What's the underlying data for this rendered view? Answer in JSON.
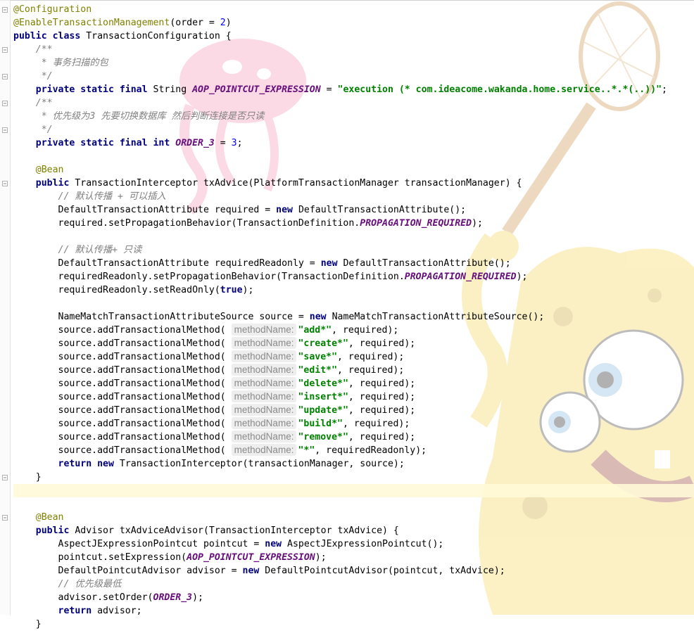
{
  "code": {
    "lines": [
      [
        [
          "ann",
          "@Configuration"
        ]
      ],
      [
        [
          "ann",
          "@EnableTransactionManagement"
        ],
        [
          "p",
          "(order = "
        ],
        [
          "num",
          "2"
        ],
        [
          "p",
          ")"
        ]
      ],
      [
        [
          "kw",
          "public class "
        ],
        [
          "p",
          "TransactionConfiguration {"
        ]
      ],
      [
        [
          "p",
          "    "
        ],
        [
          "cm",
          "/**"
        ]
      ],
      [
        [
          "p",
          "    "
        ],
        [
          "cm",
          " * 事务扫描的包"
        ]
      ],
      [
        [
          "p",
          "    "
        ],
        [
          "cm",
          " */"
        ]
      ],
      [
        [
          "p",
          "    "
        ],
        [
          "kw",
          "private static final "
        ],
        [
          "p",
          "String "
        ],
        [
          "const",
          "AOP_POINTCUT_EXPRESSION"
        ],
        [
          "p",
          " = "
        ],
        [
          "str",
          "\"execution (* com.ideacome.wakanda.home.service..*.*(..))\""
        ],
        [
          "p",
          ";"
        ]
      ],
      [
        [
          "p",
          "    "
        ],
        [
          "cm",
          "/**"
        ]
      ],
      [
        [
          "p",
          "    "
        ],
        [
          "cm",
          " * 优先级为3 先要切换数据库 然后判断连接是否只读"
        ]
      ],
      [
        [
          "p",
          "    "
        ],
        [
          "cm",
          " */"
        ]
      ],
      [
        [
          "p",
          "    "
        ],
        [
          "kw",
          "private static final int "
        ],
        [
          "const",
          "ORDER_3"
        ],
        [
          "p",
          " = "
        ],
        [
          "num",
          "3"
        ],
        [
          "p",
          ";"
        ]
      ],
      [
        [
          "p",
          ""
        ]
      ],
      [
        [
          "p",
          "    "
        ],
        [
          "ann",
          "@Bean"
        ]
      ],
      [
        [
          "p",
          "    "
        ],
        [
          "kw",
          "public "
        ],
        [
          "p",
          "TransactionInterceptor txAdvice(PlatformTransactionManager transactionManager) {"
        ]
      ],
      [
        [
          "p",
          "        "
        ],
        [
          "cm",
          "// 默认传播 + 可以插入"
        ]
      ],
      [
        [
          "p",
          "        DefaultTransactionAttribute required = "
        ],
        [
          "kw",
          "new "
        ],
        [
          "p",
          "DefaultTransactionAttribute();"
        ]
      ],
      [
        [
          "p",
          "        required.setPropagationBehavior(TransactionDefinition."
        ],
        [
          "const",
          "PROPAGATION_REQUIRED"
        ],
        [
          "p",
          ");"
        ]
      ],
      [
        [
          "p",
          ""
        ]
      ],
      [
        [
          "p",
          "        "
        ],
        [
          "cm",
          "// 默认传播+ 只读"
        ]
      ],
      [
        [
          "p",
          "        DefaultTransactionAttribute requiredReadonly = "
        ],
        [
          "kw",
          "new "
        ],
        [
          "p",
          "DefaultTransactionAttribute();"
        ]
      ],
      [
        [
          "p",
          "        requiredReadonly.setPropagationBehavior(TransactionDefinition."
        ],
        [
          "const",
          "PROPAGATION_REQUIRED"
        ],
        [
          "p",
          ");"
        ]
      ],
      [
        [
          "p",
          "        requiredReadonly.setReadOnly("
        ],
        [
          "kw",
          "true"
        ],
        [
          "p",
          ");"
        ]
      ],
      [
        [
          "p",
          ""
        ]
      ],
      [
        [
          "p",
          "        NameMatchTransactionAttributeSource source = "
        ],
        [
          "kw",
          "new "
        ],
        [
          "p",
          "NameMatchTransactionAttributeSource();"
        ]
      ],
      [
        [
          "p",
          "        source.addTransactionalMethod( "
        ],
        [
          "hint",
          "methodName:"
        ],
        [
          "str",
          "\"add*\""
        ],
        [
          "p",
          ", required);"
        ]
      ],
      [
        [
          "p",
          "        source.addTransactionalMethod( "
        ],
        [
          "hint",
          "methodName:"
        ],
        [
          "str",
          "\"create*\""
        ],
        [
          "p",
          ", required);"
        ]
      ],
      [
        [
          "p",
          "        source.addTransactionalMethod( "
        ],
        [
          "hint",
          "methodName:"
        ],
        [
          "str",
          "\"save*\""
        ],
        [
          "p",
          ", required);"
        ]
      ],
      [
        [
          "p",
          "        source.addTransactionalMethod( "
        ],
        [
          "hint",
          "methodName:"
        ],
        [
          "str",
          "\"edit*\""
        ],
        [
          "p",
          ", required);"
        ]
      ],
      [
        [
          "p",
          "        source.addTransactionalMethod( "
        ],
        [
          "hint",
          "methodName:"
        ],
        [
          "str",
          "\"delete*\""
        ],
        [
          "p",
          ", required);"
        ]
      ],
      [
        [
          "p",
          "        source.addTransactionalMethod( "
        ],
        [
          "hint",
          "methodName:"
        ],
        [
          "str",
          "\"insert*\""
        ],
        [
          "p",
          ", required);"
        ]
      ],
      [
        [
          "p",
          "        source.addTransactionalMethod( "
        ],
        [
          "hint",
          "methodName:"
        ],
        [
          "str",
          "\"update*\""
        ],
        [
          "p",
          ", required);"
        ]
      ],
      [
        [
          "p",
          "        source.addTransactionalMethod( "
        ],
        [
          "hint",
          "methodName:"
        ],
        [
          "str",
          "\"build*\""
        ],
        [
          "p",
          ", required);"
        ]
      ],
      [
        [
          "p",
          "        source.addTransactionalMethod( "
        ],
        [
          "hint",
          "methodName:"
        ],
        [
          "str",
          "\"remove*\""
        ],
        [
          "p",
          ", required);"
        ]
      ],
      [
        [
          "p",
          "        source.addTransactionalMethod( "
        ],
        [
          "hint",
          "methodName:"
        ],
        [
          "str",
          "\"*\""
        ],
        [
          "p",
          ", requiredReadonly);"
        ]
      ],
      [
        [
          "p",
          "        "
        ],
        [
          "kw",
          "return new "
        ],
        [
          "p",
          "TransactionInterceptor(transactionManager, source);"
        ]
      ],
      [
        [
          "p",
          "    }"
        ]
      ],
      [
        [
          "p",
          ""
        ]
      ],
      [
        [
          "p",
          ""
        ]
      ],
      [
        [
          "p",
          "    "
        ],
        [
          "ann",
          "@Bean"
        ]
      ],
      [
        [
          "p",
          "    "
        ],
        [
          "kw",
          "public "
        ],
        [
          "p",
          "Advisor txAdviceAdvisor(TransactionInterceptor txAdvice) {"
        ]
      ],
      [
        [
          "p",
          "        AspectJExpressionPointcut pointcut = "
        ],
        [
          "kw",
          "new "
        ],
        [
          "p",
          "AspectJExpressionPointcut();"
        ]
      ],
      [
        [
          "p",
          "        pointcut.setExpression("
        ],
        [
          "const",
          "AOP_POINTCUT_EXPRESSION"
        ],
        [
          "p",
          ");"
        ]
      ],
      [
        [
          "p",
          "        DefaultPointcutAdvisor advisor = "
        ],
        [
          "kw",
          "new "
        ],
        [
          "p",
          "DefaultPointcutAdvisor(pointcut, txAdvice);"
        ]
      ],
      [
        [
          "p",
          "        "
        ],
        [
          "cm",
          "// 优先级最低"
        ]
      ],
      [
        [
          "p",
          "        advisor.setOrder("
        ],
        [
          "const",
          "ORDER_3"
        ],
        [
          "p",
          ");"
        ]
      ],
      [
        [
          "p",
          "        "
        ],
        [
          "kw",
          "return "
        ],
        [
          "p",
          "advisor;"
        ]
      ],
      [
        [
          "p",
          "    }"
        ]
      ]
    ],
    "caret_line": 36
  },
  "colors": {
    "keyword": "#000080",
    "annotation": "#808000",
    "string": "#008000",
    "constant": "#660e7a",
    "comment": "#808080",
    "number": "#0000ff"
  },
  "icons": {
    "fold": "fold-marker-icon",
    "background": "background-image-icon"
  }
}
